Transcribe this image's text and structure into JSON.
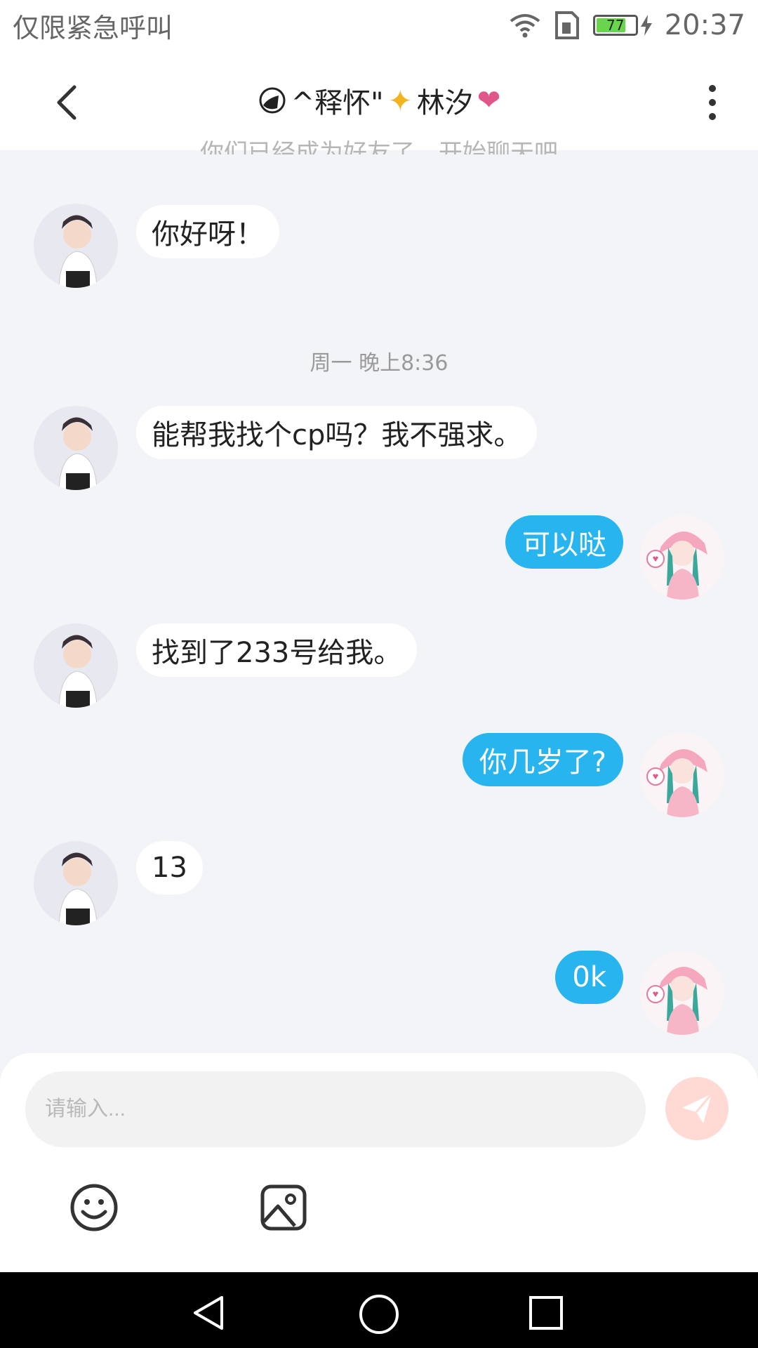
{
  "status_bar": {
    "carrier_text": "仅限紧急呼叫",
    "battery": "77",
    "battery_level": 0.77,
    "time": "20:37",
    "icons": [
      "wifi-icon",
      "sim-icon",
      "battery-icon",
      "charging-icon"
    ]
  },
  "header": {
    "title_part1": "^释怀\"",
    "title_part2": "林汐",
    "sparkle": "✦",
    "heart": "❤",
    "icons": [
      "back-icon",
      "more-icon"
    ]
  },
  "chat": {
    "cut_off_text": "你们已经成为好友了，开始聊天吧",
    "timestamp": "周一 晚上8:36",
    "messages": [
      {
        "side": "left",
        "text": "你好呀！"
      },
      {
        "side": "left",
        "text": "能帮我找个cp吗？我不强求。"
      },
      {
        "side": "right",
        "text": "可以哒"
      },
      {
        "side": "left",
        "text": "找到了233号给我。"
      },
      {
        "side": "right",
        "text": "你几岁了?"
      },
      {
        "side": "left",
        "text": "13"
      },
      {
        "side": "right",
        "text": "0k"
      }
    ]
  },
  "input": {
    "placeholder": "请输入..."
  },
  "toolbar_icons": [
    "send-icon",
    "emoji-icon",
    "image-icon"
  ],
  "colors": {
    "accent_blue": "#28b4ef",
    "send_button": "#ffd9d3",
    "background": "#f3f4f7"
  }
}
